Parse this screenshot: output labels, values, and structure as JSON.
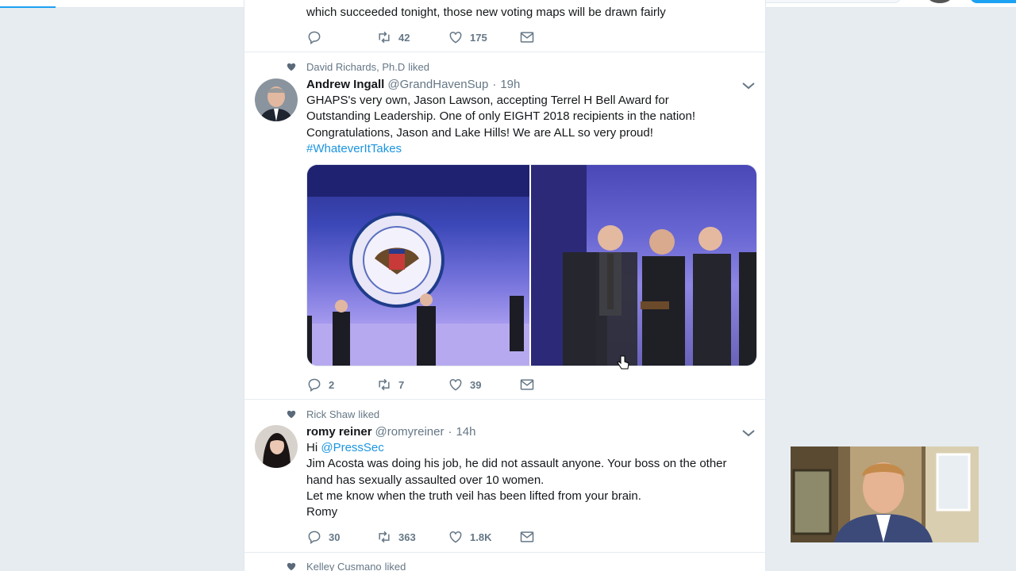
{
  "partial_tweet": {
    "text": "which succeeded tonight, those new voting maps will be drawn fairly",
    "counts": {
      "reply": "",
      "retweet": "42",
      "like": "175"
    }
  },
  "tweets": [
    {
      "liked_by": "David Richards, Ph.D",
      "liked_suffix": "liked",
      "name": "Andrew Ingall",
      "handle": "@GrandHavenSup",
      "time": "19h",
      "text_lines": [
        "GHAPS's very own, Jason Lawson, accepting Terrel H Bell Award for",
        "Outstanding Leadership. One of only EIGHT 2018 recipients in the nation!",
        "Congratulations, Jason and Lake Hills! We are ALL so very proud!"
      ],
      "hashtag": "#WhateverItTakes",
      "counts": {
        "reply": "2",
        "retweet": "7",
        "like": "39"
      }
    },
    {
      "liked_by": "Rick Shaw",
      "liked_suffix": "liked",
      "name": "romy reiner",
      "handle": "@romyreiner",
      "time": "14h",
      "greeting": "Hi",
      "mention": "@PressSec",
      "text_lines": [
        "Jim Acosta was doing his job, he did not assault anyone. Your boss on the other",
        "hand has sexually assaulted over 10 women.",
        "Let me know when the truth veil has been lifted from your brain.",
        "Romy"
      ],
      "counts": {
        "reply": "30",
        "retweet": "363",
        "like": "1.8K"
      }
    },
    {
      "liked_by": "Kelley Cusmano",
      "liked_suffix": "liked"
    }
  ],
  "icons": {
    "reply": "reply-icon",
    "retweet": "retweet-icon",
    "like": "heart-icon",
    "dm": "envelope-icon",
    "caret": "chevron-down-icon"
  },
  "colors": {
    "link": "#1b95e0",
    "muted": "#657786",
    "background": "#e6ecf0"
  }
}
